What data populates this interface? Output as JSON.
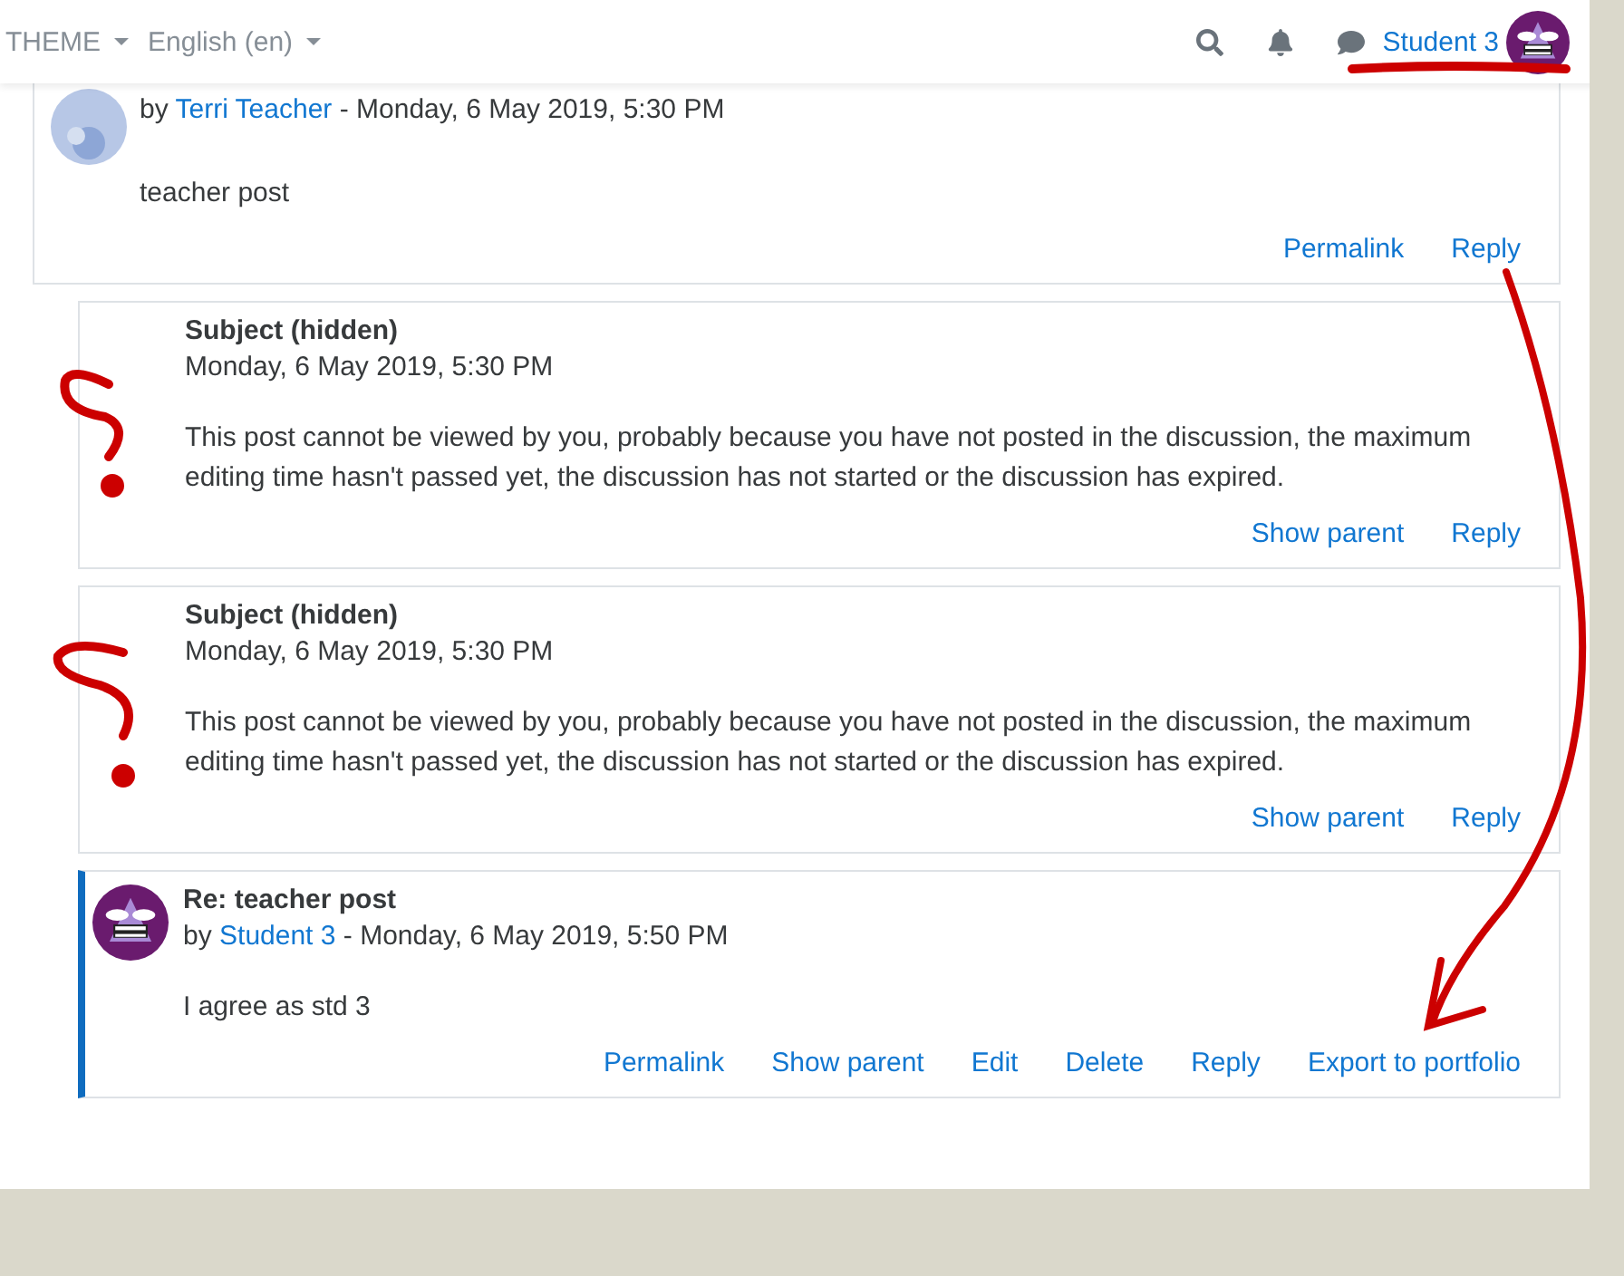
{
  "navbar": {
    "menus": [
      {
        "label": "THEME"
      },
      {
        "label": "English (en)"
      }
    ],
    "user": {
      "name": "Student 3"
    }
  },
  "post": {
    "byline_prefix": "by",
    "author": "Terri Teacher",
    "date_suffix": "- Monday, 6 May 2019, 5:30 PM",
    "body": "teacher post",
    "actions": [
      "Permalink",
      "Reply"
    ],
    "replies": [
      {
        "kind": "hidden",
        "highlighted": false,
        "subject": "Subject (hidden)",
        "date": "Monday, 6 May 2019, 5:30 PM",
        "body": "This post cannot be viewed by you, probably because you have not posted in the discussion, the maximum editing time hasn't passed yet, the discussion has not started or the discussion has expired.",
        "actions": [
          "Show parent",
          "Reply"
        ]
      },
      {
        "kind": "hidden",
        "highlighted": false,
        "subject": "Subject (hidden)",
        "date": "Monday, 6 May 2019, 5:30 PM",
        "body": "This post cannot be viewed by you, probably because you have not posted in the discussion, the maximum editing time hasn't passed yet, the discussion has not started or the discussion has expired.",
        "actions": [
          "Show parent",
          "Reply"
        ]
      },
      {
        "kind": "visible",
        "highlighted": true,
        "subject": "Re: teacher post",
        "byline_prefix": "by",
        "author": "Student 3",
        "date_suffix": "- Monday, 6 May 2019, 5:50 PM",
        "body": "I agree as std 3",
        "actions": [
          "Permalink",
          "Show parent",
          "Edit",
          "Delete",
          "Reply",
          "Export to portfolio"
        ]
      }
    ]
  }
}
